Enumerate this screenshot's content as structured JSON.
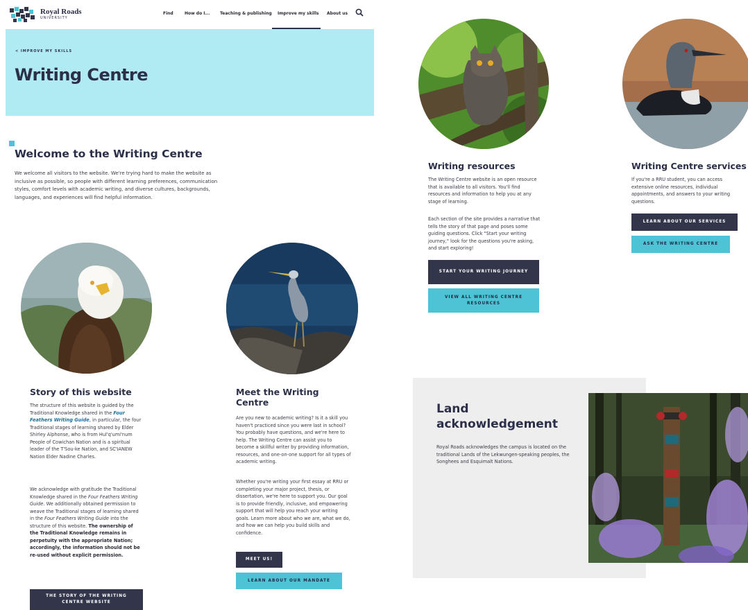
{
  "header": {
    "logo_name": "Royal Roads",
    "logo_sub": "UNIVERSITY",
    "nav": [
      "Find",
      "How do I...",
      "Teaching & publishing",
      "Improve my skills",
      "About us"
    ],
    "search_icon": "search-icon"
  },
  "hero": {
    "breadcrumb": "< IMPROVE MY SKILLS",
    "title": "Writing Centre"
  },
  "welcome": {
    "title": "Welcome to the Writing Centre",
    "body": "We welcome all visitors to the website. We're trying hard to make the website as inclusive as possible, so people with different learning preferences, communication styles, comfort levels with academic writing, and diverse cultures, backgrounds, languages, and experiences will find helpful information."
  },
  "story": {
    "title": "Story of this website",
    "p1_a": "The structure of this website is guided by the Traditional Knowledge shared in the ",
    "p1_link": "Four Feathers Writing Guide",
    "p1_b": ", in particular, the four Traditional stages of learning shared by Elder Shirley Alphonse, who is from Hul'q'umi'num People of Cowichan Nation and is a spiritual leader of the T'Sou-ke Nation, and SC'IANEW Nation Elder Nadine Charles.",
    "p2_a": "We acknowledge with gratitude the Traditional Knowledge shared in the ",
    "p2_em1": "Four Feathers Writing Guide",
    "p2_b": ". We additionally obtained permission to weave the Traditional stages of learning shared in the ",
    "p2_em2": "Four Feathers Writing Guide",
    "p2_c": " into the structure of this website. ",
    "p2_strong": "The ownership of the Traditional Knowledge remains in perpetuity with the appropriate Nation; accordingly, the information should not be re-used without explicit permission.",
    "button": "THE STORY OF THE WRITING CENTRE WEBSITE"
  },
  "meet": {
    "title": "Meet the Writing Centre",
    "p1": "Are you new to academic writing? Is it a skill you haven't practiced since you were last in school? You probably have questions, and we're here to help. The Writing Centre can assist you to become a skillful writer by providing information, resources, and one-on-one support for all types of academic writing.",
    "p2": "Whether you're writing your first essay at RRU or completing your major project, thesis, or dissertation, we're here to support you. Our goal is to provide friendly, inclusive, and empowering support that will help you reach your writing goals. Learn more about who we are, what we do, and how we can help you build skills and confidence.",
    "button_dark": "MEET US!",
    "button_light": "LEARN ABOUT OUR MANDATE"
  },
  "resources": {
    "title": "Writing resources",
    "p1": "The Writing Centre website is an open resource that is available to all visitors. You'll find resources and information to help you at any stage of learning.",
    "p2": "Each section of the site provides a narrative that tells the story of that page and poses some guiding questions. Click \"Start your writing journey,\" look for the questions you're asking, and start exploring!",
    "button_dark": "START YOUR WRITING JOURNEY",
    "button_light": "VIEW ALL WRITING CENTRE RESOURCES"
  },
  "services": {
    "title": "Writing Centre services",
    "p1": "If you're a RRU student, you can access extensive online resources, individual appointments, and answers to your writing questions.",
    "button_dark": "LEARN ABOUT OUR SERVICES",
    "button_light": "ASK THE WRITING CENTRE"
  },
  "land": {
    "title": "Land acknowledgement",
    "body": "Royal Roads acknowledges the campus is located on the traditional Lands of the Lekwungen-speaking peoples, the Songhees and Esquimalt Nations."
  },
  "colors": {
    "hero_bg": "#b0ebf3",
    "accent": "#4ec3d6",
    "dark_button": "#33354a",
    "heading": "#2b2f48"
  }
}
